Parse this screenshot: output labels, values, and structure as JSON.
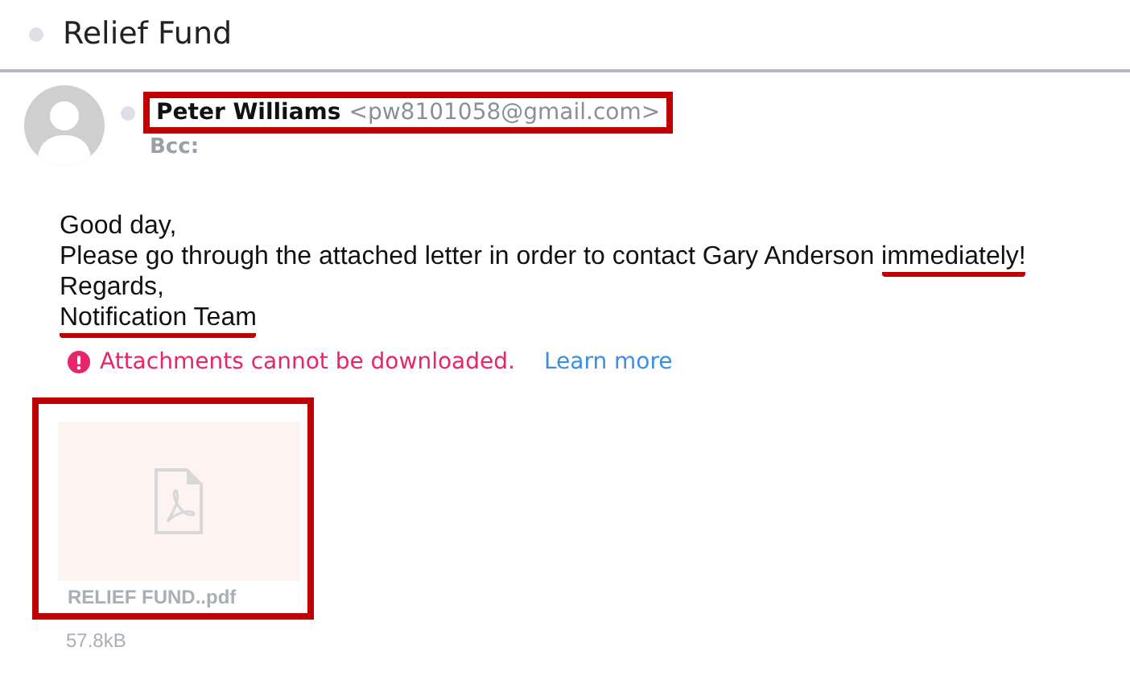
{
  "subject": "Relief Fund",
  "sender": {
    "name": "Peter Williams",
    "email": "<pw8101058@gmail.com>",
    "highlighted": true
  },
  "bcc_label": "Bcc:",
  "body": [
    [
      {
        "text": "Good day,",
        "underlined": false
      }
    ],
    [
      {
        "text": "Please go through the attached letter in order to contact Gary Anderson ",
        "underlined": false
      },
      {
        "text": "immediately!",
        "underlined": true
      }
    ],
    [
      {
        "text": "Regards,",
        "underlined": false
      }
    ],
    [
      {
        "text": "Notification Team",
        "underlined": true
      }
    ]
  ],
  "warning": {
    "text": "Attachments cannot be downloaded.",
    "link": "Learn more"
  },
  "attachment": {
    "filename": "RELIEF FUND..pdf",
    "size": "57.8kB",
    "highlighted": true
  }
}
